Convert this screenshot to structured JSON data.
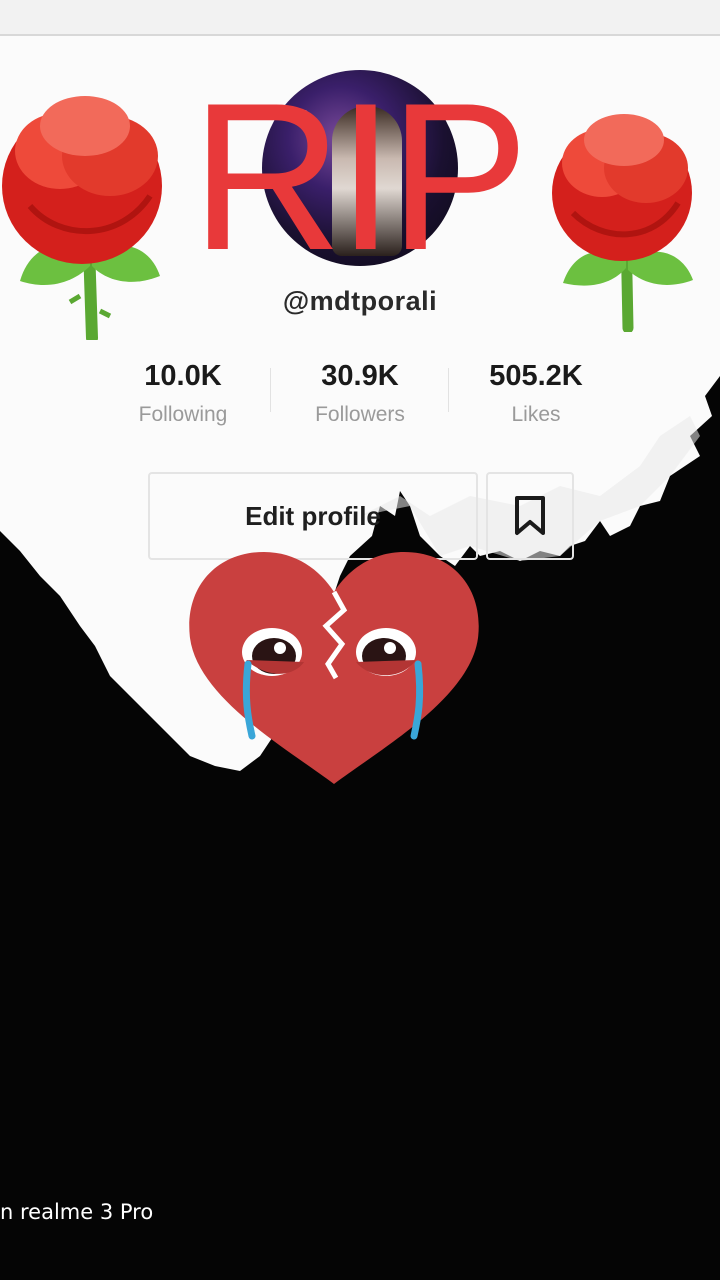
{
  "overlay": {
    "rip_text": "RIP"
  },
  "profile": {
    "handle": "@mdtporali",
    "stats": [
      {
        "value": "10.0K",
        "label": "Following"
      },
      {
        "value": "30.9K",
        "label": "Followers"
      },
      {
        "value": "505.2K",
        "label": "Likes"
      }
    ],
    "edit_button": "Edit profile"
  },
  "watermark": "n realme 3 Pro",
  "colors": {
    "rip_red": "#e8393a",
    "heart_red": "#c9403f",
    "rose_red": "#d4201c",
    "leaf_green": "#5aa832"
  },
  "icons": [
    "rose-emoji-icon",
    "broken-heart-crying-icon",
    "bookmark-icon"
  ]
}
